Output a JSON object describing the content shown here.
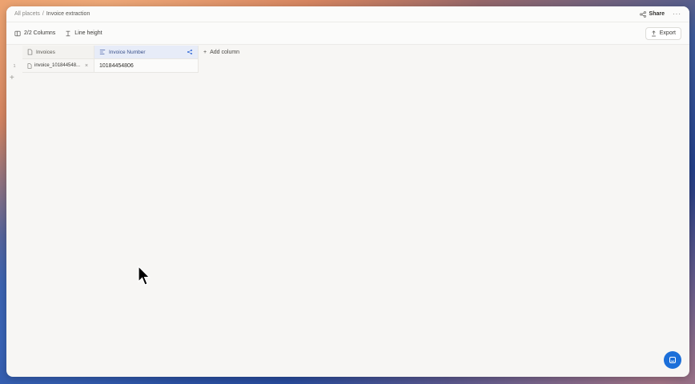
{
  "breadcrumb": {
    "root": "All placets",
    "separator": "/",
    "current": "Invoice extraction"
  },
  "topbar": {
    "share_label": "Share",
    "more_label": "···"
  },
  "toolbar": {
    "columns_label": "2/2 Columns",
    "line_height_label": "Line height",
    "export_label": "Export"
  },
  "table": {
    "columns": [
      {
        "label": "Invoices",
        "icon": "file-icon"
      },
      {
        "label": "Invoice Number",
        "icon": "text-lines-icon"
      }
    ],
    "add_column_label": "Add column",
    "rows": [
      {
        "index": "1",
        "file": "invoice_101844548...",
        "invoice_number": "10184454806"
      }
    ],
    "add_row_label": "+"
  },
  "colors": {
    "accent": "#1c6fd9",
    "column_highlight": "#e7ecf8"
  }
}
